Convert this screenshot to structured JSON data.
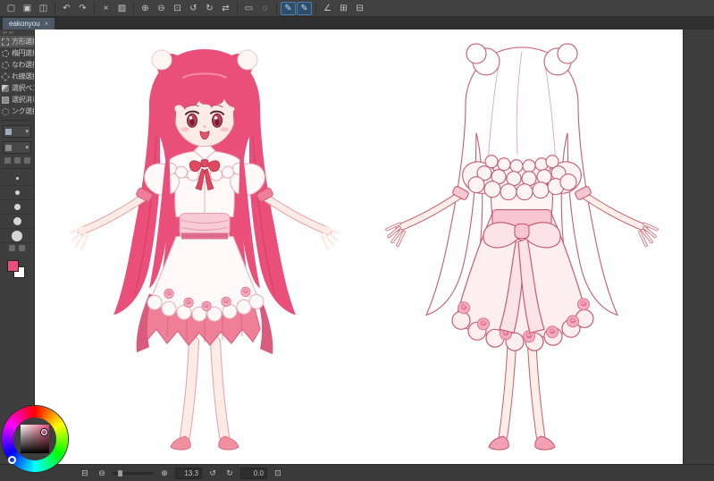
{
  "palette": {
    "ui_bg": "#3d3d3d",
    "accent_blue": "#4d7ea8",
    "hair": "#e94f78",
    "hair_dark": "#d23b63",
    "skin": "#fdece6",
    "dress_white": "#fffaf9",
    "pink": "#ee7f97",
    "pink_dark": "#d95c7e",
    "pale_pink": "#fdeef0",
    "line": "#c65d72",
    "ribbon": "#e0495f",
    "rose": "#f3aebd"
  },
  "toolbar": {
    "icons": [
      {
        "name": "new-file",
        "glyph": "▢"
      },
      {
        "name": "open-file",
        "glyph": "▣"
      },
      {
        "name": "save",
        "glyph": "◫"
      },
      {
        "name": "undo",
        "glyph": "↶"
      },
      {
        "name": "redo",
        "glyph": "↷"
      },
      {
        "name": "clear",
        "glyph": "×"
      },
      {
        "name": "fill",
        "glyph": "▨"
      },
      {
        "name": "zoom-in",
        "glyph": "⊕"
      },
      {
        "name": "zoom-out",
        "glyph": "⊖"
      },
      {
        "name": "fit-view",
        "glyph": "⊡"
      },
      {
        "name": "rotate-left",
        "glyph": "↺"
      },
      {
        "name": "rotate-right",
        "glyph": "↻"
      },
      {
        "name": "flip-horizontal",
        "glyph": "⇄"
      },
      {
        "name": "select-rectangle",
        "glyph": "▭"
      },
      {
        "name": "select-lasso",
        "glyph": "◌"
      },
      {
        "name": "pen",
        "glyph": "✎",
        "active": true
      },
      {
        "name": "brush",
        "glyph": "✎",
        "active": true
      },
      {
        "name": "ruler",
        "glyph": "∠"
      },
      {
        "name": "grid",
        "glyph": "⊞"
      },
      {
        "name": "panels",
        "glyph": "⊟"
      }
    ]
  },
  "tab": {
    "label": "eakonyou",
    "close": "×"
  },
  "subtool_panel": {
    "items": [
      {
        "label": "方形選択"
      },
      {
        "label": "楕円選択"
      },
      {
        "label": "なわ選択"
      },
      {
        "label": "れ線選択"
      },
      {
        "label": "選択ペン"
      },
      {
        "label": "選択消し"
      },
      {
        "label": "ンク選択"
      }
    ],
    "dropdown_arrow": "▾"
  },
  "statusbar": {
    "doc_icon": "⊟",
    "zoom_out": "⊖",
    "zoom_in": "⊕",
    "zoom_value": "13.3",
    "rotate_left": "↺",
    "rotate_right": "↻",
    "rotate_value": "0.0",
    "fit": "⊡"
  },
  "canvas": {
    "artwork_alt": "Character design sheet: girl with long pink twin-tail hair in white and pink frilled dress, front view (colored) and back view (light line art with back bow)"
  }
}
